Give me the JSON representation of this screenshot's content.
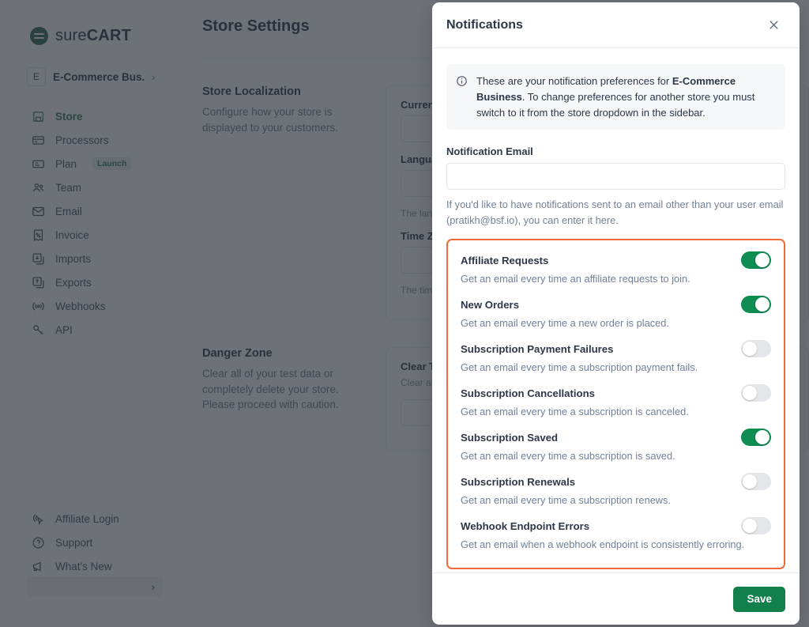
{
  "brand": {
    "name_light": "sure",
    "name_bold": "CART",
    "logo_icon": "surecart-logo-icon"
  },
  "store_switcher": {
    "avatar_letter": "E",
    "name": "E-Commerce Bus...",
    "chevron": "›"
  },
  "sidebar": {
    "items": [
      {
        "label": "Store",
        "icon": "store-icon",
        "active": true,
        "badge": ""
      },
      {
        "label": "Processors",
        "icon": "credit-card-icon",
        "active": false,
        "badge": ""
      },
      {
        "label": "Plan",
        "icon": "ticket-icon",
        "active": false,
        "badge": "Launch"
      },
      {
        "label": "Team",
        "icon": "users-icon",
        "active": false,
        "badge": ""
      },
      {
        "label": "Email",
        "icon": "envelope-icon",
        "active": false,
        "badge": ""
      },
      {
        "label": "Invoice",
        "icon": "invoice-icon",
        "active": false,
        "badge": ""
      },
      {
        "label": "Imports",
        "icon": "import-icon",
        "active": false,
        "badge": ""
      },
      {
        "label": "Exports",
        "icon": "export-icon",
        "active": false,
        "badge": ""
      },
      {
        "label": "Webhooks",
        "icon": "webhook-icon",
        "active": false,
        "badge": ""
      },
      {
        "label": "API",
        "icon": "key-icon",
        "active": false,
        "badge": ""
      }
    ],
    "bottom_items": [
      {
        "label": "Affiliate Login",
        "icon": "cursor-click-icon"
      },
      {
        "label": "Support",
        "icon": "question-circle-icon"
      },
      {
        "label": "What's New",
        "icon": "megaphone-icon"
      }
    ],
    "footer_bar": {
      "chevron": "›"
    }
  },
  "page": {
    "title": "Store Settings",
    "sections": [
      {
        "heading": "Store Localization",
        "description": "Configure how your store is displayed to your customers.",
        "fields": [
          {
            "label": "Currency",
            "hint": ""
          },
          {
            "label": "Language",
            "hint": "The language of your store."
          },
          {
            "label": "Time Zone",
            "hint": "The timezone of your store."
          }
        ]
      },
      {
        "heading": "Danger Zone",
        "description": "Clear all of your test data or completely delete your store. Please proceed with caution.",
        "fields": [
          {
            "label": "Clear Test Data",
            "hint": "Clear all test data permanently."
          }
        ]
      }
    ]
  },
  "modal": {
    "title": "Notifications",
    "close_icon": "close-icon",
    "notice": {
      "icon": "info-circle-icon",
      "text_before": "These are your notification preferences for ",
      "store_name": "E-Commerce Business",
      "text_after": ". To change preferences for another store you must switch to it from the store dropdown in the sidebar."
    },
    "email_field": {
      "label": "Notification Email",
      "value": "",
      "placeholder": "",
      "help": "If you'd like to have notifications sent to an email other than your user email (pratikh@bsf.io), you can enter it here."
    },
    "toggles": [
      {
        "name": "Affiliate Requests",
        "description": "Get an email every time an affiliate requests to join.",
        "on": true
      },
      {
        "name": "New Orders",
        "description": "Get an email every time a new order is placed.",
        "on": true
      },
      {
        "name": "Subscription Payment Failures",
        "description": "Get an email every time a subscription payment fails.",
        "on": false
      },
      {
        "name": "Subscription Cancellations",
        "description": "Get an email every time a subscription is canceled.",
        "on": false
      },
      {
        "name": "Subscription Saved",
        "description": "Get an email every time a subscription is saved.",
        "on": true
      },
      {
        "name": "Subscription Renewals",
        "description": "Get an email every time a subscription renews.",
        "on": false
      },
      {
        "name": "Webhook Endpoint Errors",
        "description": "Get an email when a webhook endpoint is consistently erroring.",
        "on": false
      }
    ],
    "save_label": "Save"
  },
  "colors": {
    "brand_green": "#2e7d52",
    "toggle_on": "#0e8c52",
    "toggle_off": "#e4e6ea",
    "highlight_border": "#f26b36",
    "save_button": "#11804c",
    "overlay": "rgba(42,46,54,.68)"
  }
}
